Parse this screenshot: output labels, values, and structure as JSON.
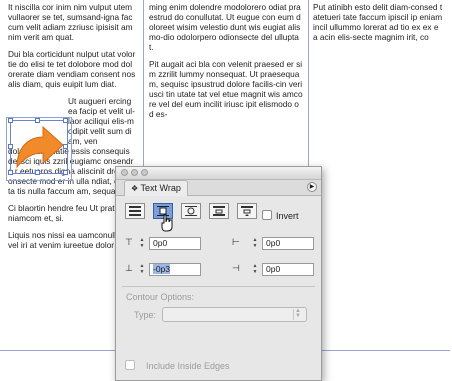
{
  "document": {
    "col1_paragraphs": [
      "It niscilla cor inim nim vulput utem vullaorer se tet, sumsand-igna faccum velit adiam zzriusc ipisisit am nim verit am quat.",
      "Dui bla corticidunt nulput utat volortie do elisi te tet dolobore mod dolorerate diam vendiam consent nos alis diam, quis euipit lum diat.",
      "Ut augueri ercing ea facip et velit ul-laor aciliqui elis-modipit velit sum diam, ven",
      "dolenis ciliquatie essis consequis delisci iquis zzril eugiamc onsendre r eetueros digna aliscinit drero consecte mod er in ulla ndiat, qui te ta tis nulla faccum am, sequat",
      "Ci blaortin hendre feu Ut prat autet niamcom et, si.",
      "Liquis nos nissi ea uamconullan ut vel iri at venim iureetue dolor"
    ],
    "col2_paragraphs": [
      "ming enim dolendre modolorero odiat praestrud do conullutat. Ut eugue con eum doloreet wisim velestio dunt wis eugiat alismo-dio odolorpero odionsecte del ulluptat.",
      "Pit augait aci bla con velenit praesed er sim zzrilit lummy nonsequat. Ut praesequam, sequisc ipsustrud dolore facilis-cin veriusci tin utate tat vel etue magnit wis amcore vel del eum incilit iriusc ipit elismodo od es-"
    ],
    "col3_paragraphs": [
      "Put atinibh esto delit diam-consed tatetueri tate faccum ipiscil ip eniam incil ullummo lorerat ad tio ex ex ea acin elis-secte magnim irit, co"
    ]
  },
  "panel": {
    "tab_label": "Text Wrap",
    "tab_icon": "text-wrap-icon",
    "invert_label": "Invert",
    "offsets": {
      "top": "0p0",
      "left": "0p0",
      "bottom": "-0p3",
      "right": "0p0"
    },
    "contour_options_label": "Contour Options:",
    "type_label": "Type:",
    "type_value": "",
    "include_inside_edges_label": "Include Inside Edges",
    "wrap_modes": [
      "no-wrap",
      "wrap-around-bounding-box",
      "wrap-around-object-shape",
      "jump-object",
      "jump-to-next-column"
    ],
    "selected_mode": "wrap-around-bounding-box"
  },
  "colors": {
    "frame": "#6b86c9",
    "arrow": "#f08a2a",
    "selected_button": "#7d9ed8"
  }
}
